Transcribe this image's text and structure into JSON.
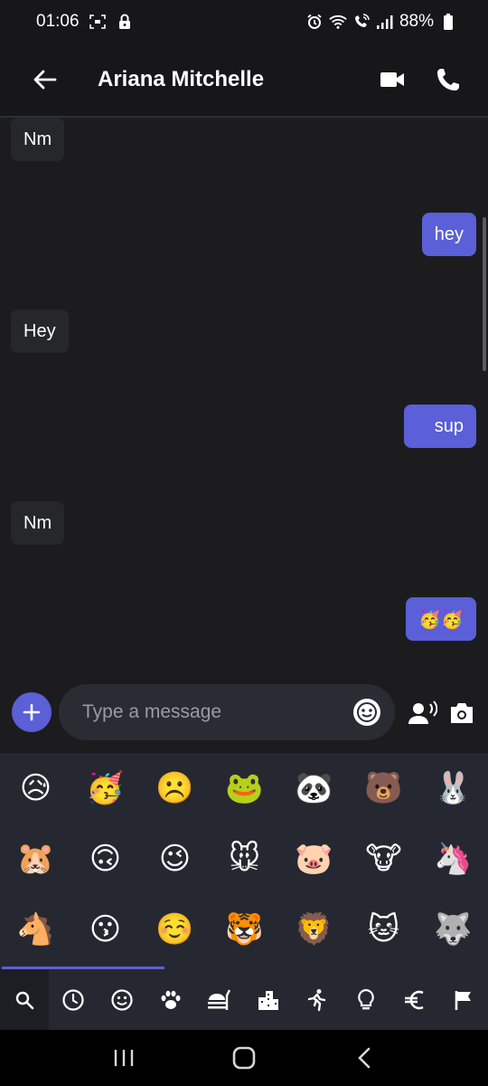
{
  "status": {
    "time": "01:06",
    "battery": "88%"
  },
  "header": {
    "contact_name": "Ariana Mitchelle"
  },
  "messages": [
    {
      "dir": "in",
      "text": "Nm"
    },
    {
      "dir": "out",
      "text": "hey"
    },
    {
      "dir": "in",
      "text": "Hey"
    },
    {
      "dir": "out",
      "text": "sup"
    },
    {
      "dir": "in",
      "text": "Nm"
    },
    {
      "dir": "out",
      "text": "🥳🥳"
    }
  ],
  "composer": {
    "placeholder": "Type a message"
  },
  "emoji_grid": [
    "😥",
    "🥳",
    "☹️",
    "🐸",
    "🐼",
    "🐻",
    "🐰",
    "🐹",
    "🙃",
    "😉",
    "🐭",
    "🐷",
    "🐮",
    "🦄",
    "🐴",
    "😗",
    "☺️",
    "🐯",
    "🦁",
    "🐱",
    "🐺"
  ],
  "emoji_categories": [
    "search",
    "recent",
    "smileys",
    "animals",
    "food",
    "travel",
    "activities",
    "objects",
    "symbols",
    "flags"
  ],
  "colors": {
    "accent": "#5b5fd8",
    "background": "#1c1c1f",
    "panel": "#252830"
  }
}
